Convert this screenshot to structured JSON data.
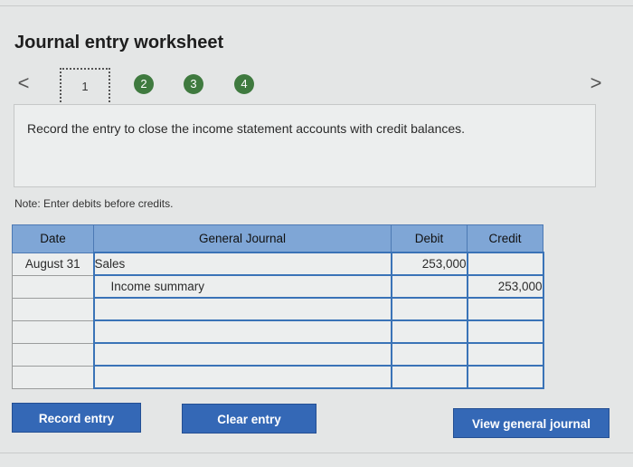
{
  "title": "Journal entry worksheet",
  "nav": {
    "prev": "<",
    "next": ">"
  },
  "steps": [
    "1",
    "2",
    "3",
    "4"
  ],
  "instruction": "Record the entry to close the income statement accounts with credit balances.",
  "note": "Note: Enter debits before credits.",
  "table": {
    "headers": {
      "date": "Date",
      "journal": "General Journal",
      "debit": "Debit",
      "credit": "Credit"
    },
    "rows": [
      {
        "date": "August 31",
        "account": "Sales",
        "debit": "253,000",
        "credit": ""
      },
      {
        "date": "",
        "account": "Income summary",
        "debit": "",
        "credit": "253,000"
      },
      {
        "date": "",
        "account": "",
        "debit": "",
        "credit": ""
      },
      {
        "date": "",
        "account": "",
        "debit": "",
        "credit": ""
      },
      {
        "date": "",
        "account": "",
        "debit": "",
        "credit": ""
      },
      {
        "date": "",
        "account": "",
        "debit": "",
        "credit": ""
      }
    ]
  },
  "buttons": {
    "record": "Record entry",
    "clear": "Clear entry",
    "view": "View general journal"
  },
  "colors": {
    "accent": "#3468b6",
    "header": "#7fa6d6",
    "step": "#3f7a3f"
  }
}
